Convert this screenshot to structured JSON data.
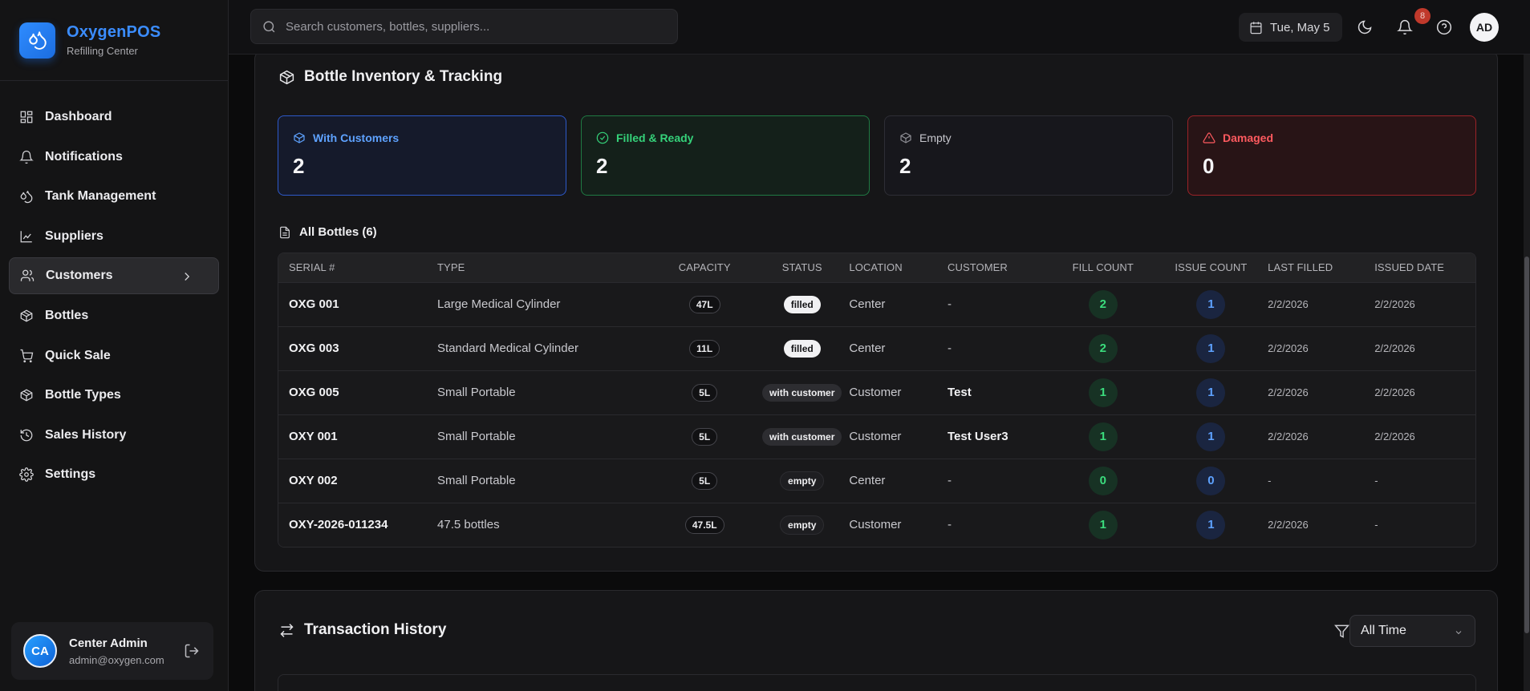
{
  "brand": {
    "name": "OxygenPOS",
    "subtitle": "Refilling Center"
  },
  "sidebar": {
    "items": [
      {
        "label": "Dashboard",
        "icon": "grid-icon"
      },
      {
        "label": "Notifications",
        "icon": "bell-icon"
      },
      {
        "label": "Tank Management",
        "icon": "droplets-icon"
      },
      {
        "label": "Suppliers",
        "icon": "chart-icon"
      },
      {
        "label": "Customers",
        "icon": "users-icon",
        "active": true
      },
      {
        "label": "Bottles",
        "icon": "package-icon"
      },
      {
        "label": "Quick Sale",
        "icon": "cart-icon"
      },
      {
        "label": "Bottle Types",
        "icon": "package-icon"
      },
      {
        "label": "Sales History",
        "icon": "history-icon"
      },
      {
        "label": "Settings",
        "icon": "gear-icon"
      }
    ],
    "user": {
      "initials": "CA",
      "name": "Center Admin",
      "email": "admin@oxygen.com"
    }
  },
  "header": {
    "search_placeholder": "Search customers, bottles, suppliers...",
    "date": "Tue, May 5",
    "notification_count": "8",
    "user_initials": "AD"
  },
  "inventory": {
    "title": "Bottle Inventory & Tracking",
    "stats": [
      {
        "label": "With Customers",
        "value": "2",
        "color": "#5ea2ff"
      },
      {
        "label": "Filled & Ready",
        "value": "2",
        "color": "#35d27a"
      },
      {
        "label": "Empty",
        "value": "2",
        "color": "#c6c6cc"
      },
      {
        "label": "Damaged",
        "value": "0",
        "color": "#ff5a5f"
      }
    ],
    "list_title": "All Bottles (6)",
    "columns": [
      "Serial #",
      "Type",
      "Capacity",
      "Status",
      "Location",
      "Customer",
      "Fill Count",
      "Issue Count",
      "Last Filled",
      "Issued Date"
    ],
    "rows": [
      {
        "serial": "OXG 001",
        "type": "Large Medical Cylinder",
        "capacity": "47L",
        "status": "filled",
        "location": "Center",
        "customer": "-",
        "fill": "2",
        "issue": "1",
        "last_filled": "2/2/2026",
        "issued": "2/2/2026"
      },
      {
        "serial": "OXG 003",
        "type": "Standard Medical Cylinder",
        "capacity": "11L",
        "status": "filled",
        "location": "Center",
        "customer": "-",
        "fill": "2",
        "issue": "1",
        "last_filled": "2/2/2026",
        "issued": "2/2/2026"
      },
      {
        "serial": "OXG 005",
        "type": "Small Portable",
        "capacity": "5L",
        "status": "with customer",
        "location": "Customer",
        "customer": "Test",
        "fill": "1",
        "issue": "1",
        "last_filled": "2/2/2026",
        "issued": "2/2/2026"
      },
      {
        "serial": "OXY 001",
        "type": "Small Portable",
        "capacity": "5L",
        "status": "with customer",
        "location": "Customer",
        "customer": "Test User3",
        "fill": "1",
        "issue": "1",
        "last_filled": "2/2/2026",
        "issued": "2/2/2026"
      },
      {
        "serial": "OXY 002",
        "type": "Small Portable",
        "capacity": "5L",
        "status": "empty",
        "location": "Center",
        "customer": "-",
        "fill": "0",
        "issue": "0",
        "last_filled": "-",
        "issued": "-"
      },
      {
        "serial": "OXY-2026-011234",
        "type": "47.5 bottles",
        "capacity": "47.5L",
        "status": "empty",
        "location": "Customer",
        "customer": "-",
        "fill": "1",
        "issue": "1",
        "last_filled": "2/2/2026",
        "issued": "-"
      }
    ]
  },
  "transactions": {
    "title": "Transaction History",
    "filter_value": "All Time"
  }
}
